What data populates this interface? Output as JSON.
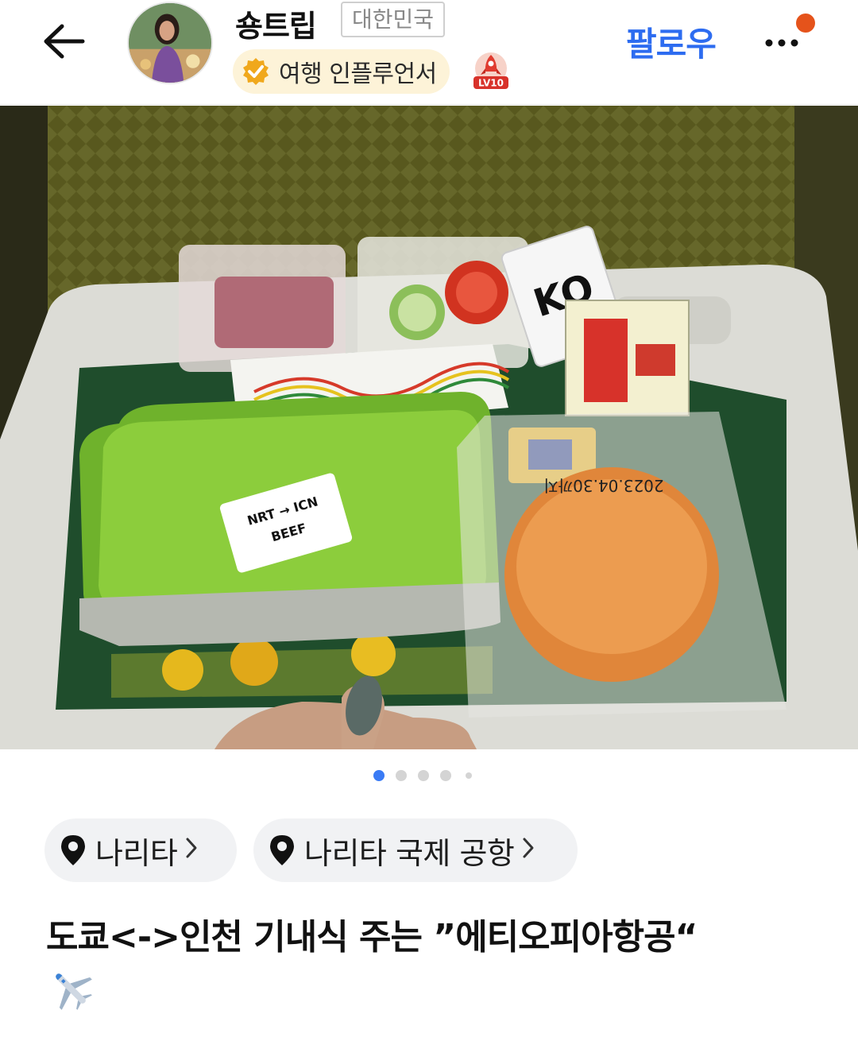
{
  "header": {
    "username": "숑트립",
    "country": "대한민국",
    "badge_label": "여행 인플루언서",
    "level_label": "LV10",
    "follow_label": "팔로우"
  },
  "photo": {
    "label_route": "NRT → ICN",
    "label_meal": "BEEF",
    "packet_label": "KO",
    "date_stamp": "2023.04.30까지"
  },
  "carousel": {
    "total": 5,
    "active_index": 0
  },
  "location_chips": [
    {
      "label": "나리타"
    },
    {
      "label": "나리타 국제 공항"
    }
  ],
  "post": {
    "title": "도쿄<->인천 기내식 주는 ”에티오피아항공“"
  },
  "colors": {
    "accent": "#2d6cf0",
    "notification": "#e5531b",
    "badge_bg": "#fdf3d8",
    "chip_bg": "#f1f2f4"
  }
}
